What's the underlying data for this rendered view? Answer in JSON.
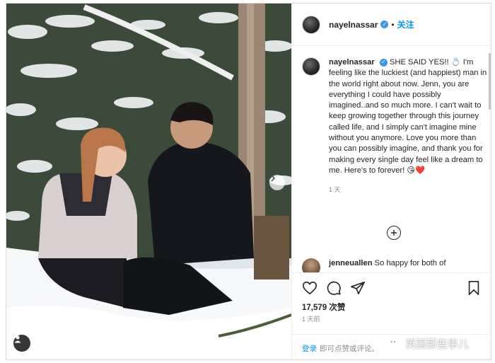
{
  "header": {
    "username": "nayelnassar",
    "dot": "•",
    "follow_label": "关注"
  },
  "caption": {
    "username": "nayelnassar",
    "text": "SHE SAID YES!! 💍 I'm feeling like the luckiest (and happiest) man in the world right about now. Jenn, you are everything I could have possibly imagined..and so much more. I can't wait to keep growing together through this journey called life, and I simply can't imagine mine without you anymore. Love you more than you can possibly imagine, and thank you for making every single day feel like a dream to me. Here's to forever! 😘❤️",
    "time": "1 天"
  },
  "comment": {
    "username": "jenneuallen",
    "text": "So happy for both of"
  },
  "footer": {
    "likes": "17,579 次赞",
    "time": "1 天前",
    "login_link": "登录",
    "login_text": "即可点赞或评论。"
  },
  "watermark": {
    "text": "英国那些事儿"
  },
  "icons": {
    "verified": "verified-badge-icon",
    "next": "chevron-right-icon",
    "user_tag": "user-tag-icon",
    "load_more": "plus-circle-icon",
    "like": "heart-icon",
    "comment": "comment-icon",
    "share": "share-icon",
    "save": "bookmark-icon",
    "watermark": "wechat-icon"
  },
  "colors": {
    "link_blue": "#0095f6",
    "verified_blue": "#3897f0",
    "muted_text": "#8e8e8e"
  }
}
